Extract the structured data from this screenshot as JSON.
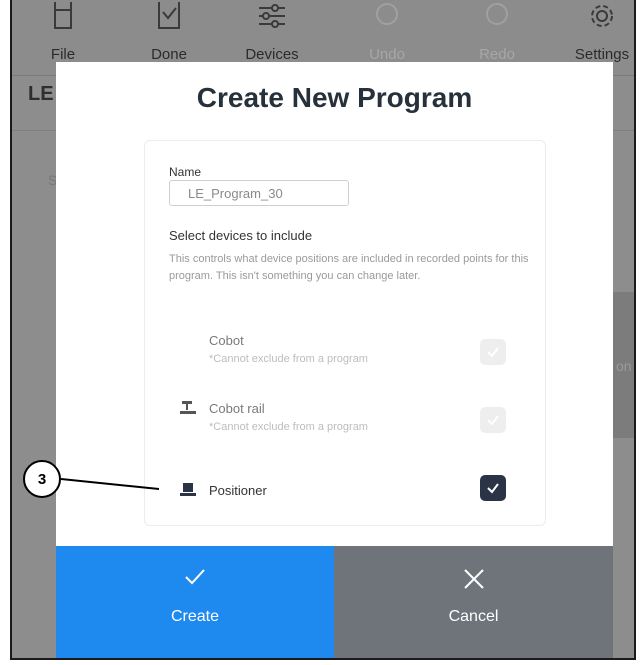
{
  "toolbar": {
    "items": [
      {
        "label": "File",
        "icon": "file-icon",
        "enabled": true
      },
      {
        "label": "Done",
        "icon": "check-box-icon",
        "enabled": true
      },
      {
        "label": "Devices",
        "icon": "sliders-icon",
        "enabled": true
      },
      {
        "label": "Undo",
        "icon": "undo-icon",
        "enabled": false
      },
      {
        "label": "Redo",
        "icon": "redo-icon",
        "enabled": false
      },
      {
        "label": "Settings",
        "icon": "gear-icon",
        "enabled": true
      }
    ]
  },
  "background": {
    "title": "LE",
    "s": "S",
    "right_text": "on"
  },
  "dialog": {
    "title": "Create New Program",
    "name_label": "Name",
    "name_value": "LE_Program_30",
    "select_title": "Select devices to include",
    "select_desc": "This controls what device positions are included in recorded points for this program. This isn't something you can change later.",
    "devices": [
      {
        "name": "Cobot",
        "note": "*Cannot exclude from a program",
        "checked": true,
        "locked": true,
        "icon": "none"
      },
      {
        "name": "Cobot rail",
        "note": "*Cannot exclude from a program",
        "checked": true,
        "locked": true,
        "icon": "rail-icon"
      },
      {
        "name": "Positioner",
        "note": "",
        "checked": true,
        "locked": false,
        "icon": "positioner-icon"
      }
    ],
    "create_label": "Create",
    "cancel_label": "Cancel"
  },
  "callout": {
    "number": "3"
  },
  "colors": {
    "accent": "#1e89ee",
    "cancel": "#6e7479",
    "checkbox_active": "#2b3446",
    "overlay": "#8d8d8d"
  }
}
